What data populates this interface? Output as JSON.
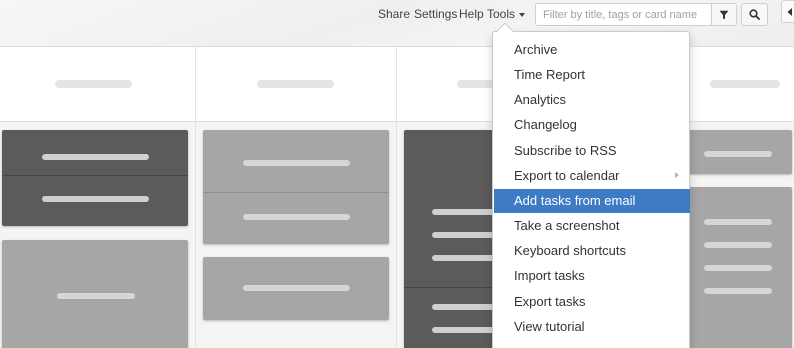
{
  "topnav": {
    "share": "Share",
    "settings": "Settings",
    "help": "Help",
    "tools": "Tools"
  },
  "filter": {
    "placeholder": "Filter by title, tags or card name",
    "value": ""
  },
  "icons": {
    "filter": "funnel-icon",
    "search": "magnifier-icon",
    "collapse": "caret-left-icon",
    "dropdown": "caret-down-icon",
    "submenu": "caret-right-icon"
  },
  "colors": {
    "highlight": "#3d7bc5",
    "card_dark": "#5b5b5b",
    "card_light": "#a6a6a6"
  },
  "tools_menu": {
    "highlighted_item": "Add tasks from email",
    "items": [
      "Archive",
      "Time Report",
      "Analytics",
      "Changelog",
      "Subscribe to RSS",
      "Export to calendar",
      "Add tasks from email",
      "Take a screenshot",
      "Keyboard shortcuts",
      "Import tasks",
      "Export tasks",
      "View tutorial"
    ]
  }
}
